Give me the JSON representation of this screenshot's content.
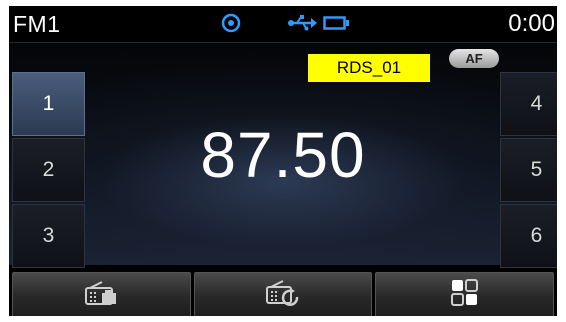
{
  "status": {
    "band": "FM1",
    "clock": "0:00",
    "icons": [
      "target-icon",
      "usb-icon",
      "battery-icon"
    ],
    "accent": "#2f9bff"
  },
  "radio": {
    "rds_name": "RDS_01",
    "af_label": "AF",
    "frequency": "87.50"
  },
  "presets": {
    "left": [
      "1",
      "2",
      "3"
    ],
    "right": [
      "4",
      "5",
      "6"
    ],
    "active": "1"
  },
  "bottom_bar": {
    "buttons": [
      "radio-list-icon",
      "radio-scan-icon",
      "menu-grid-icon"
    ]
  }
}
